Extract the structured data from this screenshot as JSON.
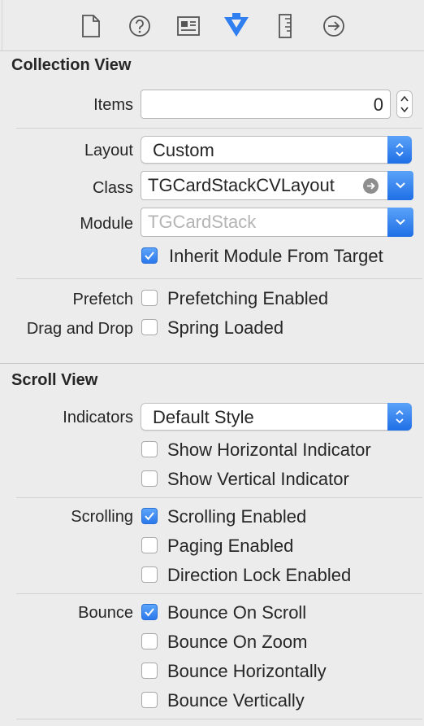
{
  "toolbar": {
    "icons": [
      "file-icon",
      "help-icon",
      "identity-icon",
      "attributes-icon",
      "size-icon",
      "connections-icon"
    ],
    "accent": "#2f7ff0"
  },
  "collection_view": {
    "title": "Collection View",
    "items_label": "Items",
    "items_value": "0",
    "layout_label": "Layout",
    "layout_value": "Custom",
    "class_label": "Class",
    "class_value": "TGCardStackCVLayout",
    "module_label": "Module",
    "module_placeholder": "TGCardStack",
    "inherit_label": "Inherit Module From Target",
    "inherit_checked": true,
    "prefetch_label": "Prefetch",
    "prefetch_option": "Prefetching Enabled",
    "prefetch_checked": false,
    "dragdrop_label": "Drag and Drop",
    "dragdrop_option": "Spring Loaded",
    "dragdrop_checked": false
  },
  "scroll_view": {
    "title": "Scroll View",
    "indicators_label": "Indicators",
    "indicators_value": "Default Style",
    "show_horizontal": "Show Horizontal Indicator",
    "show_vertical": "Show Vertical Indicator",
    "scrolling_label": "Scrolling",
    "scrolling_enabled": "Scrolling Enabled",
    "paging_enabled": "Paging Enabled",
    "direction_lock": "Direction Lock Enabled",
    "bounce_label": "Bounce",
    "bounce_on_scroll": "Bounce On Scroll",
    "bounce_on_zoom": "Bounce On Zoom",
    "bounce_horizontally": "Bounce Horizontally",
    "bounce_vertically": "Bounce Vertically"
  }
}
